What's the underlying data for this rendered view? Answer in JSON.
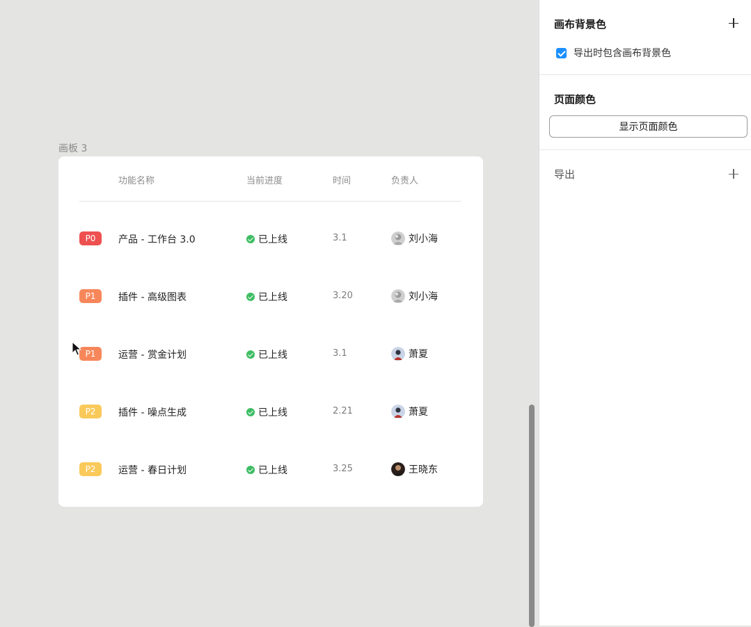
{
  "canvas": {
    "frame_label": "画板 3",
    "columns": [
      "功能名称",
      "当前进度",
      "时间",
      "负责人"
    ],
    "rows": [
      {
        "priority": "P0",
        "priority_color": "#ee5050",
        "name": "产品 - 工作台 3.0",
        "status": "已上线",
        "time": "3.1",
        "owner": "刘小海",
        "avatar_icon": "avatar-gray-icon"
      },
      {
        "priority": "P1",
        "priority_color": "#f7875b",
        "name": "插件 - 高级图表",
        "status": "已上线",
        "time": "3.20",
        "owner": "刘小海",
        "avatar_icon": "avatar-gray-icon"
      },
      {
        "priority": "P1",
        "priority_color": "#f7875b",
        "name": "运营 - 赏金计划",
        "status": "已上线",
        "time": "3.1",
        "owner": "萧夏",
        "avatar_icon": "avatar-blue-icon"
      },
      {
        "priority": "P2",
        "priority_color": "#f9c95a",
        "name": "插件 - 噪点生成",
        "status": "已上线",
        "time": "2.21",
        "owner": "萧夏",
        "avatar_icon": "avatar-blue-icon"
      },
      {
        "priority": "P2",
        "priority_color": "#f9c95a",
        "name": "运营 - 春日计划",
        "status": "已上线",
        "time": "3.25",
        "owner": "王晓东",
        "avatar_icon": "avatar-dark-icon"
      }
    ],
    "status_color": "#3ebd63"
  },
  "panel": {
    "canvas_bg": {
      "title": "画布背景色",
      "checkbox_label": "导出时包含画布背景色",
      "checked": true
    },
    "page_color": {
      "title": "页面颜色",
      "button_label": "显示页面颜色"
    },
    "export": {
      "title": "导出"
    }
  }
}
